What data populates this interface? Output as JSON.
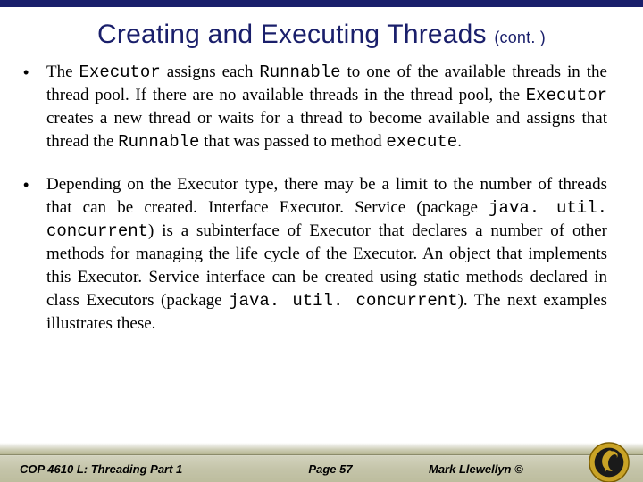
{
  "title_main": "Creating and Executing Threads",
  "title_suffix": "(cont. )",
  "bullets": [
    {
      "segments": [
        {
          "t": "The ",
          "c": false
        },
        {
          "t": "Executor",
          "c": true
        },
        {
          "t": " assigns each ",
          "c": false
        },
        {
          "t": "Runnable",
          "c": true
        },
        {
          "t": " to one of the available threads in the thread pool.  If there are no available threads in the thread pool, the ",
          "c": false
        },
        {
          "t": "Executor",
          "c": true
        },
        {
          "t": " creates a new thread or waits for a thread to become available and assigns that thread the ",
          "c": false
        },
        {
          "t": "Runnable",
          "c": true
        },
        {
          "t": " that was passed to method ",
          "c": false
        },
        {
          "t": "execute",
          "c": true
        },
        {
          "t": ".",
          "c": false
        }
      ]
    },
    {
      "segments": [
        {
          "t": "Depending on the Executor type, there may be a limit to the number of threads that can be created.   Interface Executor. Service (package ",
          "c": false
        },
        {
          "t": "java. util. concurrent",
          "c": true
        },
        {
          "t": ") is a subinterface of Executor that declares a number of other methods for managing the life cycle of the Executor.  An object that implements this Executor. Service interface can be created using static methods declared in class Executors (package ",
          "c": false
        },
        {
          "t": "java. util. concurrent",
          "c": true
        },
        {
          "t": ").  The next examples illustrates these.",
          "c": false
        }
      ]
    }
  ],
  "footer": {
    "left": "COP 4610 L: Threading Part 1",
    "center": "Page 57",
    "right": "Mark Llewellyn ©"
  },
  "logo_name": "ucf-pegasus-logo"
}
